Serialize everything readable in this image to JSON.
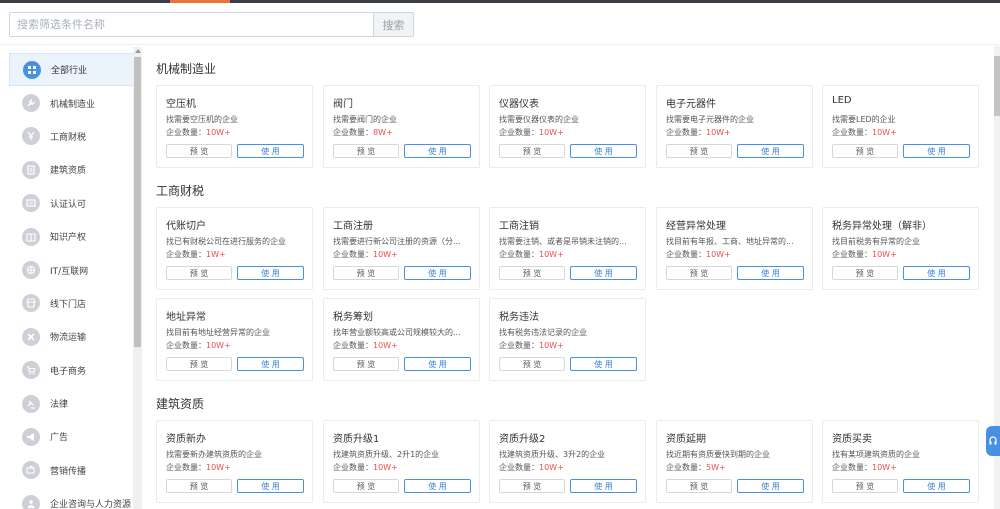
{
  "search": {
    "placeholder": "搜索筛选条件名称",
    "button": "搜索"
  },
  "sidebar": {
    "items": [
      {
        "label": "全部行业",
        "icon": "grid-icon",
        "active": true
      },
      {
        "label": "机械制造业",
        "icon": "wrench-icon"
      },
      {
        "label": "工商财税",
        "icon": "yen-icon"
      },
      {
        "label": "建筑资质",
        "icon": "document-icon"
      },
      {
        "label": "认证认可",
        "icon": "certificate-icon"
      },
      {
        "label": "知识产权",
        "icon": "book-icon"
      },
      {
        "label": "IT/互联网",
        "icon": "globe-icon"
      },
      {
        "label": "线下门店",
        "icon": "store-icon"
      },
      {
        "label": "物流运输",
        "icon": "truck-icon"
      },
      {
        "label": "电子商务",
        "icon": "cart-icon"
      },
      {
        "label": "法律",
        "icon": "gavel-icon"
      },
      {
        "label": "广告",
        "icon": "megaphone-icon"
      },
      {
        "label": "营销传播",
        "icon": "broadcast-icon"
      },
      {
        "label": "企业咨询与人力资源",
        "icon": "people-icon"
      }
    ]
  },
  "labels": {
    "count_prefix": "企业数量：",
    "preview": "预 览",
    "use": "使 用"
  },
  "sections": [
    {
      "title": "机械制造业",
      "cards": [
        {
          "title": "空压机",
          "desc": "找需要空压机的企业",
          "count": "10W+"
        },
        {
          "title": "阀门",
          "desc": "找需要阀门的企业",
          "count": "8W+"
        },
        {
          "title": "仪器仪表",
          "desc": "找需要仪器仪表的企业",
          "count": "10W+"
        },
        {
          "title": "电子元器件",
          "desc": "找需要电子元器件的企业",
          "count": "10W+"
        },
        {
          "title": "LED",
          "desc": "找需要LED的企业",
          "count": "10W+"
        }
      ]
    },
    {
      "title": "工商财税",
      "cards": [
        {
          "title": "代账切户",
          "desc": "找已有财税公司在进行服务的企业",
          "count": "1W+"
        },
        {
          "title": "工商注册",
          "desc": "找需要进行新公司注册的资源（分...",
          "count": "10W+"
        },
        {
          "title": "工商注销",
          "desc": "找需要注销、或者是吊销未注销的...",
          "count": "10W+"
        },
        {
          "title": "经营异常处理",
          "desc": "找目前有年报、工商、地址异常的...",
          "count": "10W+"
        },
        {
          "title": "税务异常处理（解非）",
          "desc": "找目前税务有异常的企业",
          "count": "10W+"
        },
        {
          "title": "地址异常",
          "desc": "找目前有地址经营异常的企业",
          "count": "10W+"
        },
        {
          "title": "税务筹划",
          "desc": "找年营业额较高或公司规模较大的...",
          "count": "10W+"
        },
        {
          "title": "税务违法",
          "desc": "找有税务违法记录的企业",
          "count": "10W+"
        }
      ]
    },
    {
      "title": "建筑资质",
      "cards": [
        {
          "title": "资质新办",
          "desc": "找需要新办建筑资质的企业",
          "count": "10W+"
        },
        {
          "title": "资质升级1",
          "desc": "找建筑资质升级、2升1的企业",
          "count": "10W+"
        },
        {
          "title": "资质升级2",
          "desc": "找建筑资质升级、3升2的企业",
          "count": "10W+"
        },
        {
          "title": "资质延期",
          "desc": "找近期有资质要快到期的企业",
          "count": "5W+"
        },
        {
          "title": "资质买卖",
          "desc": "找有某项建筑资质的企业",
          "count": "10W+"
        }
      ]
    }
  ]
}
